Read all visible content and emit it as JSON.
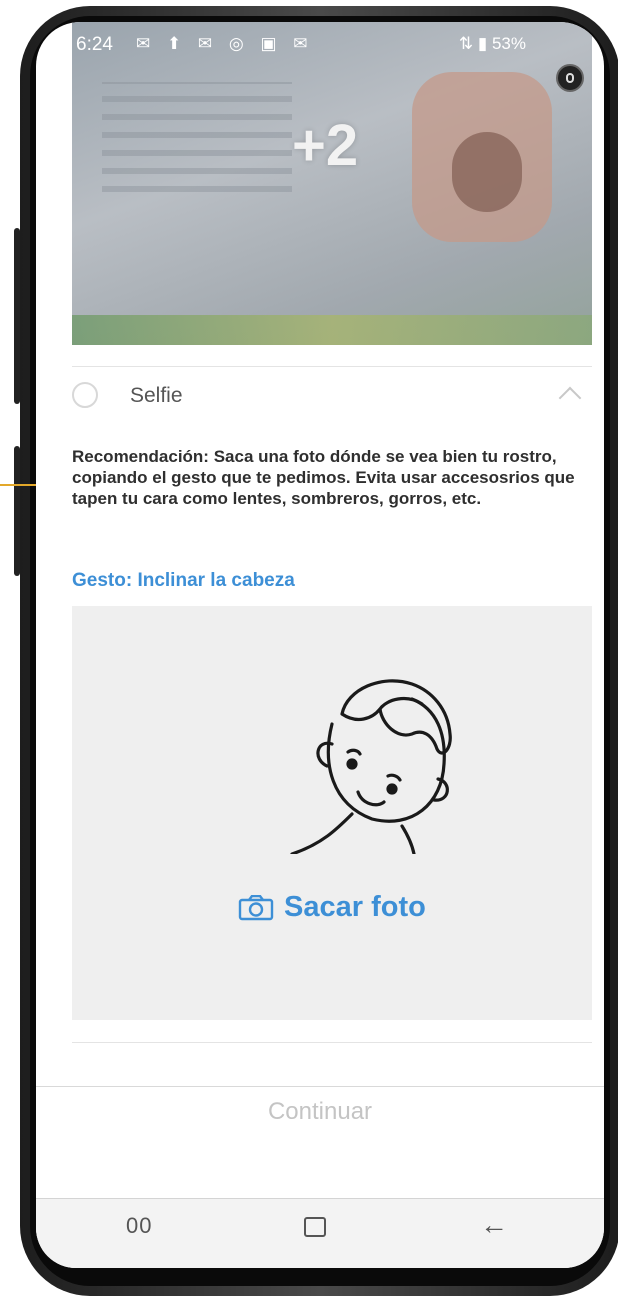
{
  "status": {
    "time": "6:24",
    "left_icons": "✉ ⬆ ✉ ◎ ▣ ✉",
    "right": "⇅ ▮ 53%"
  },
  "doc_preview": {
    "more_count": "+2"
  },
  "selfie": {
    "label": "Selfie",
    "recommendation": "Recomendación: Saca una foto dónde se vea bien tu rostro, copiando el gesto que te pedimos. Evita usar accesosrios que tapen tu cara como lentes, sombreros, gorros, etc.",
    "gesture": "Gesto: Inclinar la cabeza",
    "take_photo_label": "Sacar foto"
  },
  "footer": {
    "continue_label": "Continuar"
  },
  "nav": {
    "recents_glyph": "00",
    "back_glyph": "←"
  },
  "colors": {
    "accent_blue": "#3d8fd6",
    "gold_accent": "#e3a82a"
  }
}
